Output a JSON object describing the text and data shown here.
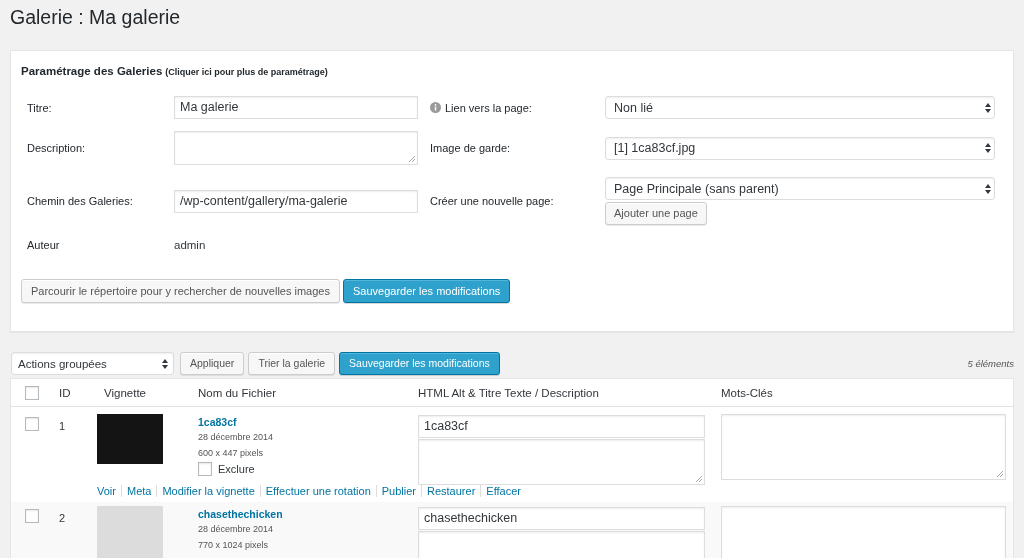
{
  "page": {
    "title": "Galerie : Ma galerie"
  },
  "settings": {
    "title": "Paramétrage des Galeries",
    "more_link": "(Cliquer ici pour plus de paramétrage)",
    "rows": [
      {
        "left": {
          "kind": "input",
          "label": "Titre:",
          "value": "Ma galerie"
        },
        "right": {
          "kind": "select",
          "label": "Lien vers la page:",
          "info": true,
          "value": "Non lié"
        }
      },
      {
        "left": {
          "kind": "textarea",
          "label": "Description:"
        },
        "right": {
          "kind": "select",
          "label": "Image de garde:",
          "info": false,
          "value": "[1] 1ca83cf.jpg"
        }
      },
      {
        "left": {
          "kind": "input",
          "label": "Chemin des Galeries:",
          "value": "/wp-content/gallery/ma-galerie"
        },
        "right": {
          "kind": "select",
          "label": "Créer une nouvelle page:",
          "info": false,
          "value": "Page Principale (sans parent)",
          "button": "Ajouter une page"
        }
      },
      {
        "left": {
          "kind": "text",
          "label": "Auteur",
          "value": "admin"
        }
      }
    ],
    "buttons": [
      {
        "kind": "secondary",
        "label": "Parcourir le répertoire pour y rechercher de nouvelles images"
      },
      {
        "kind": "primary",
        "label": "Sauvegarder les modifications"
      }
    ]
  },
  "toolbar": {
    "bulk_actions": {
      "value": "Actions groupées"
    },
    "buttons": [
      {
        "kind": "secondary",
        "label": "Appliquer"
      },
      {
        "kind": "secondary",
        "label": "Trier la galerie"
      },
      {
        "kind": "primary",
        "label": "Sauvegarder les modifications"
      }
    ],
    "count": "5 éléments"
  },
  "table": {
    "select_all": {
      "checked": false
    },
    "columns": [
      "ID",
      "Vignette",
      "Nom du Fichier",
      "HTML Alt & Titre Texte / Description",
      "Mots-Clés"
    ],
    "rows": [
      {
        "checked": false,
        "id": "1",
        "file_name": "1ca83cf",
        "date": "28 décembre 2014",
        "dimensions": "600 x 447 pixels",
        "exclude": {
          "label": "Exclure",
          "checked": false
        },
        "alt_text": "1ca83cf",
        "actions": [
          "Voir",
          "Meta",
          "Modifier la vignette",
          "Effectuer une rotation",
          "Publier",
          "Restaurer",
          "Effacer"
        ]
      },
      {
        "checked": false,
        "id": "2",
        "file_name": "chasethechicken",
        "date": "28 décembre 2014",
        "dimensions": "770 x 1024 pixels",
        "alt_text": "chasethechicken"
      }
    ]
  }
}
